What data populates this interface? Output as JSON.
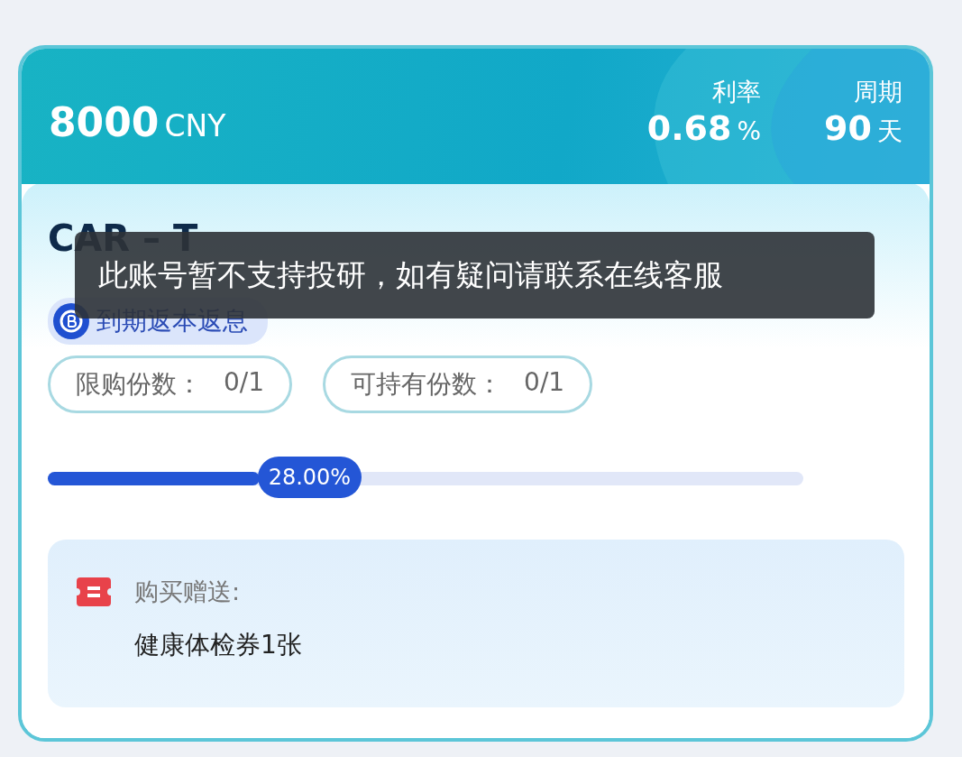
{
  "header": {
    "amount": "8000",
    "currency": "CNY",
    "stats": [
      {
        "label": "利率",
        "value": "0.68",
        "unit": "%"
      },
      {
        "label": "周期",
        "value": "90",
        "unit": "天"
      }
    ]
  },
  "product": {
    "title": "CAR – T",
    "badge": "到期返本返息",
    "chips": [
      {
        "label": "限购份数：",
        "value": "0/1"
      },
      {
        "label": "可持有份数：",
        "value": "0/1"
      }
    ],
    "progress": {
      "level": 0.28,
      "reading": "28.00%"
    }
  },
  "gift": {
    "label": "购买赠送:",
    "item": "健康体检券1张"
  },
  "toast": {
    "message": "此账号暂不支持投研，如有疑问请联系在线客服"
  }
}
